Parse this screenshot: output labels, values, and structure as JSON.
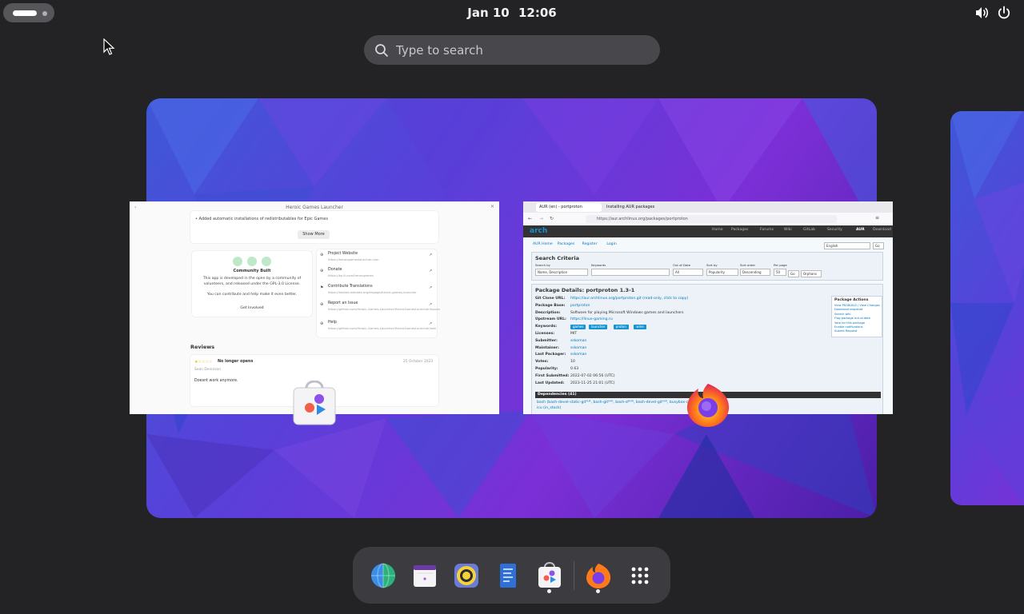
{
  "topbar": {
    "date": "Jan 10",
    "time": "12:06"
  },
  "search": {
    "placeholder": "Type to search"
  },
  "windows": {
    "heroic": {
      "title": "Heroic Games Launcher",
      "changelog_line1": "• Added automatic installations of redistributables for Epic Games",
      "show_more": "Show More",
      "community_title": "Community Built",
      "community_text1": "This app is developed in the open by a community of",
      "community_text2": "volunteers, and released under the GPL-3.0 License.",
      "community_text3": "You can contribute and help make it even better.",
      "get_involved": "Get Involved",
      "links": [
        {
          "title": "Project Website",
          "url": "https://heroicgameslauncher.com"
        },
        {
          "title": "Donate",
          "url": "https://ko-fi.com/heroicgames"
        },
        {
          "title": "Contribute Translations",
          "url": "https://hosted.weblate.org/engage/heroic-games-launcher"
        },
        {
          "title": "Report an Issue",
          "url": "https://github.com/Heroic-Games-Launcher/HeroicGamesLauncher/issues"
        },
        {
          "title": "Help",
          "url": "https://github.com/Heroic-Games-Launcher/HeroicGamesLauncher/wiki"
        }
      ],
      "reviews_heading": "Reviews",
      "review": {
        "stars": "★☆☆☆☆",
        "title": "No longer opens",
        "date": "25 October 2023",
        "author": "Sean Dennison",
        "body": "Doesnt work anymore."
      }
    },
    "firefox": {
      "tab1": "AUR (en) - portproton",
      "tab2": "Installing AUR packages",
      "url": "https://aur.archlinux.org/packages/portproton",
      "nav_items": [
        "Home",
        "Packages",
        "Forums",
        "Wiki",
        "GitLab",
        "Security",
        "AUR",
        "Download"
      ],
      "sub_nav": [
        "AUR Home",
        "Packages",
        "Register",
        "Login"
      ],
      "language": "English",
      "go": "Go",
      "search_criteria": "Search Criteria",
      "search_fields": [
        "Search by",
        "Keywords",
        "Out of Date",
        "Sort by",
        "Sort order",
        "Per page"
      ],
      "search_values": [
        "Name, Description",
        "",
        "All",
        "Popularity",
        "Descending",
        "50"
      ],
      "orphans": "Orphans",
      "pkg_heading": "Package Details: portproton 1.3-1",
      "details": [
        {
          "label": "Git Clone URL:",
          "value": "https://aur.archlinux.org/portproton.git (read-only, click to copy)"
        },
        {
          "label": "Package Base:",
          "value": "portproton"
        },
        {
          "label": "Description:",
          "value": "Software for playing Microsoft Windows games and launchers"
        },
        {
          "label": "Upstream URL:",
          "value": "https://linux-gaming.ru"
        },
        {
          "label": "Keywords:",
          "value": ""
        },
        {
          "label": "Licenses:",
          "value": "MIT"
        },
        {
          "label": "Submitter:",
          "value": "sskoman"
        },
        {
          "label": "Maintainer:",
          "value": "sskoman"
        },
        {
          "label": "Last Packager:",
          "value": "sskoman"
        },
        {
          "label": "Votes:",
          "value": "10"
        },
        {
          "label": "Popularity:",
          "value": "0.63"
        },
        {
          "label": "First Submitted:",
          "value": "2022-07-02 06:56 (UTC)"
        },
        {
          "label": "Last Updated:",
          "value": "2023-11-25 21:01 (UTC)"
        }
      ],
      "keywords": [
        "games",
        "launcher",
        "proton",
        "wine"
      ],
      "actions_title": "Package Actions",
      "actions": [
        "View PKGBUILD / View Changes",
        "Download snapshot",
        "Search wiki",
        "Flag package out-of-date",
        "Vote for this package",
        "Enable notifications",
        "Submit Request"
      ],
      "deps_heading": "Dependencies (41)",
      "deps_line": "bash (bash-devel-static-gitᴬᵁᴿ, bash-gitᴬᵁᴿ, bash-sfᴬᵁᴿ, bash-devel-gitᴬᵁᴿ, busybox-coreutils) ",
      "deps_line2": "icu (in_stock)"
    }
  },
  "dock": {
    "items": [
      {
        "name": "web-browser-globe",
        "running": false
      },
      {
        "name": "calendar",
        "running": false
      },
      {
        "name": "rhythmbox",
        "running": false
      },
      {
        "name": "text-editor",
        "running": false
      },
      {
        "name": "software-center",
        "running": true
      },
      {
        "name": "firefox",
        "running": true
      },
      {
        "name": "show-apps",
        "running": false
      }
    ]
  },
  "colors": {
    "panel": "#232326",
    "search_bg": "#48484c",
    "dock_bg": "#3c3c40",
    "wallpaper_blue": "#3f57d8",
    "wallpaper_purple": "#7b2fd6"
  }
}
